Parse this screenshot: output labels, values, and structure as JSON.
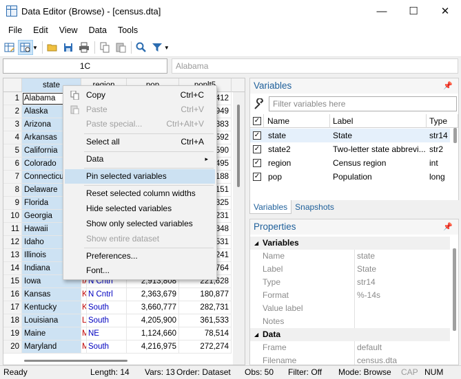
{
  "window": {
    "title": "Data Editor (Browse) - [census.dta]",
    "controls": {
      "minimize": "—",
      "maximize": "☐",
      "close": "✕"
    }
  },
  "menubar": [
    "File",
    "Edit",
    "View",
    "Data",
    "Tools"
  ],
  "toolbar": {
    "icons": [
      "edit-mode-icon",
      "browse-mode-icon",
      "open-icon",
      "save-icon",
      "print-icon",
      "copy-icon",
      "paste-icon",
      "find-icon",
      "filter-icon"
    ]
  },
  "cellbar": {
    "reference": "1C",
    "value": "Alabama"
  },
  "grid": {
    "columns": [
      "state",
      "region",
      "pop",
      "poplt5"
    ],
    "rows": [
      {
        "n": "1",
        "state": "Alabama",
        "s2": "",
        "region": "",
        "pop": "",
        "poplt5": "412"
      },
      {
        "n": "2",
        "state": "Alaska",
        "s2": "",
        "region": "",
        "pop": "",
        "poplt5": "949"
      },
      {
        "n": "3",
        "state": "Arizona",
        "s2": "",
        "region": "",
        "pop": "",
        "poplt5": "383"
      },
      {
        "n": "4",
        "state": "Arkansas",
        "s2": "",
        "region": "",
        "pop": "",
        "poplt5": "592"
      },
      {
        "n": "5",
        "state": "California",
        "s2": "",
        "region": "",
        "pop": "",
        "poplt5": "590"
      },
      {
        "n": "6",
        "state": "Colorado",
        "s2": "",
        "region": "",
        "pop": "",
        "poplt5": "495"
      },
      {
        "n": "7",
        "state": "Connecticut",
        "s2": "",
        "region": "",
        "pop": "",
        "poplt5": "188"
      },
      {
        "n": "8",
        "state": "Delaware",
        "s2": "",
        "region": "",
        "pop": "",
        "poplt5": "151"
      },
      {
        "n": "9",
        "state": "Florida",
        "s2": "",
        "region": "",
        "pop": "",
        "poplt5": "325"
      },
      {
        "n": "10",
        "state": "Georgia",
        "s2": "",
        "region": "",
        "pop": "",
        "poplt5": "231"
      },
      {
        "n": "11",
        "state": "Hawaii",
        "s2": "",
        "region": "",
        "pop": "",
        "poplt5": "348"
      },
      {
        "n": "12",
        "state": "Idaho",
        "s2": "",
        "region": "",
        "pop": "",
        "poplt5": "531"
      },
      {
        "n": "13",
        "state": "Illinois",
        "s2": "",
        "region": "",
        "pop": "",
        "poplt5": "241"
      },
      {
        "n": "14",
        "state": "Indiana",
        "s2": "",
        "region": "",
        "pop": "",
        "poplt5": "764"
      },
      {
        "n": "15",
        "state": "Iowa",
        "s2": "IA",
        "region": "N Cntrl",
        "pop": "2,913,808",
        "poplt5": "221,628"
      },
      {
        "n": "16",
        "state": "Kansas",
        "s2": "K.",
        "region": "N Cntrl",
        "pop": "2,363,679",
        "poplt5": "180,877"
      },
      {
        "n": "17",
        "state": "Kentucky",
        "s2": "K.",
        "region": "South",
        "pop": "3,660,777",
        "poplt5": "282,731"
      },
      {
        "n": "18",
        "state": "Louisiana",
        "s2": "L.",
        "region": "South",
        "pop": "4,205,900",
        "poplt5": "361,533"
      },
      {
        "n": "19",
        "state": "Maine",
        "s2": "M.",
        "region": "NE",
        "pop": "1,124,660",
        "poplt5": "78,514"
      },
      {
        "n": "20",
        "state": "Maryland",
        "s2": "M.",
        "region": "South",
        "pop": "4,216,975",
        "poplt5": "272,274"
      }
    ]
  },
  "context_menu": {
    "copy": {
      "label": "Copy",
      "shortcut": "Ctrl+C"
    },
    "paste": {
      "label": "Paste",
      "shortcut": "Ctrl+V"
    },
    "paste_special": {
      "label": "Paste special...",
      "shortcut": "Ctrl+Alt+V"
    },
    "select_all": {
      "label": "Select all",
      "shortcut": "Ctrl+A"
    },
    "data": {
      "label": "Data",
      "submenu": "▸"
    },
    "pin": {
      "label": "Pin selected variables"
    },
    "reset_widths": {
      "label": "Reset selected column widths"
    },
    "hide": {
      "label": "Hide selected variables"
    },
    "show_only": {
      "label": "Show only selected variables"
    },
    "show_entire": {
      "label": "Show entire dataset"
    },
    "preferences": {
      "label": "Preferences..."
    },
    "font": {
      "label": "Font..."
    }
  },
  "variables_panel": {
    "title": "Variables",
    "pin": "📌",
    "filter_placeholder": "Filter variables here",
    "headers": [
      "Name",
      "Label",
      "Type"
    ],
    "rows": [
      {
        "name": "state",
        "label": "State",
        "type": "str14",
        "checked": "✓"
      },
      {
        "name": "state2",
        "label": "Two-letter state abbrevi...",
        "type": "str2",
        "checked": "✓"
      },
      {
        "name": "region",
        "label": "Census region",
        "type": "int",
        "checked": "✓"
      },
      {
        "name": "pop",
        "label": "Population",
        "type": "long",
        "checked": "✓"
      }
    ]
  },
  "tabs": [
    "Variables",
    "Snapshots"
  ],
  "properties_panel": {
    "title": "Properties",
    "pin": "📌",
    "variables_group": "Variables",
    "variables": [
      {
        "key": "Name",
        "value": "state"
      },
      {
        "key": "Label",
        "value": "State"
      },
      {
        "key": "Type",
        "value": "str14"
      },
      {
        "key": "Format",
        "value": "%-14s"
      },
      {
        "key": "Value label",
        "value": ""
      },
      {
        "key": "Notes",
        "value": ""
      }
    ],
    "data_group": "Data",
    "data": [
      {
        "key": "Frame",
        "value": "default"
      },
      {
        "key": "Filename",
        "value": "census.dta"
      }
    ]
  },
  "statusbar": {
    "ready": "Ready",
    "length": "Length: 14",
    "vars": "Vars: 13",
    "order": "Order: Dataset",
    "obs": "Obs: 50",
    "filter": "Filter: Off",
    "mode": "Mode: Browse",
    "cap": "CAP",
    "num": "NUM"
  },
  "colors": {
    "accent": "#1e5f9a",
    "selection": "#cde2f3",
    "highlight": "#cce1f2"
  }
}
